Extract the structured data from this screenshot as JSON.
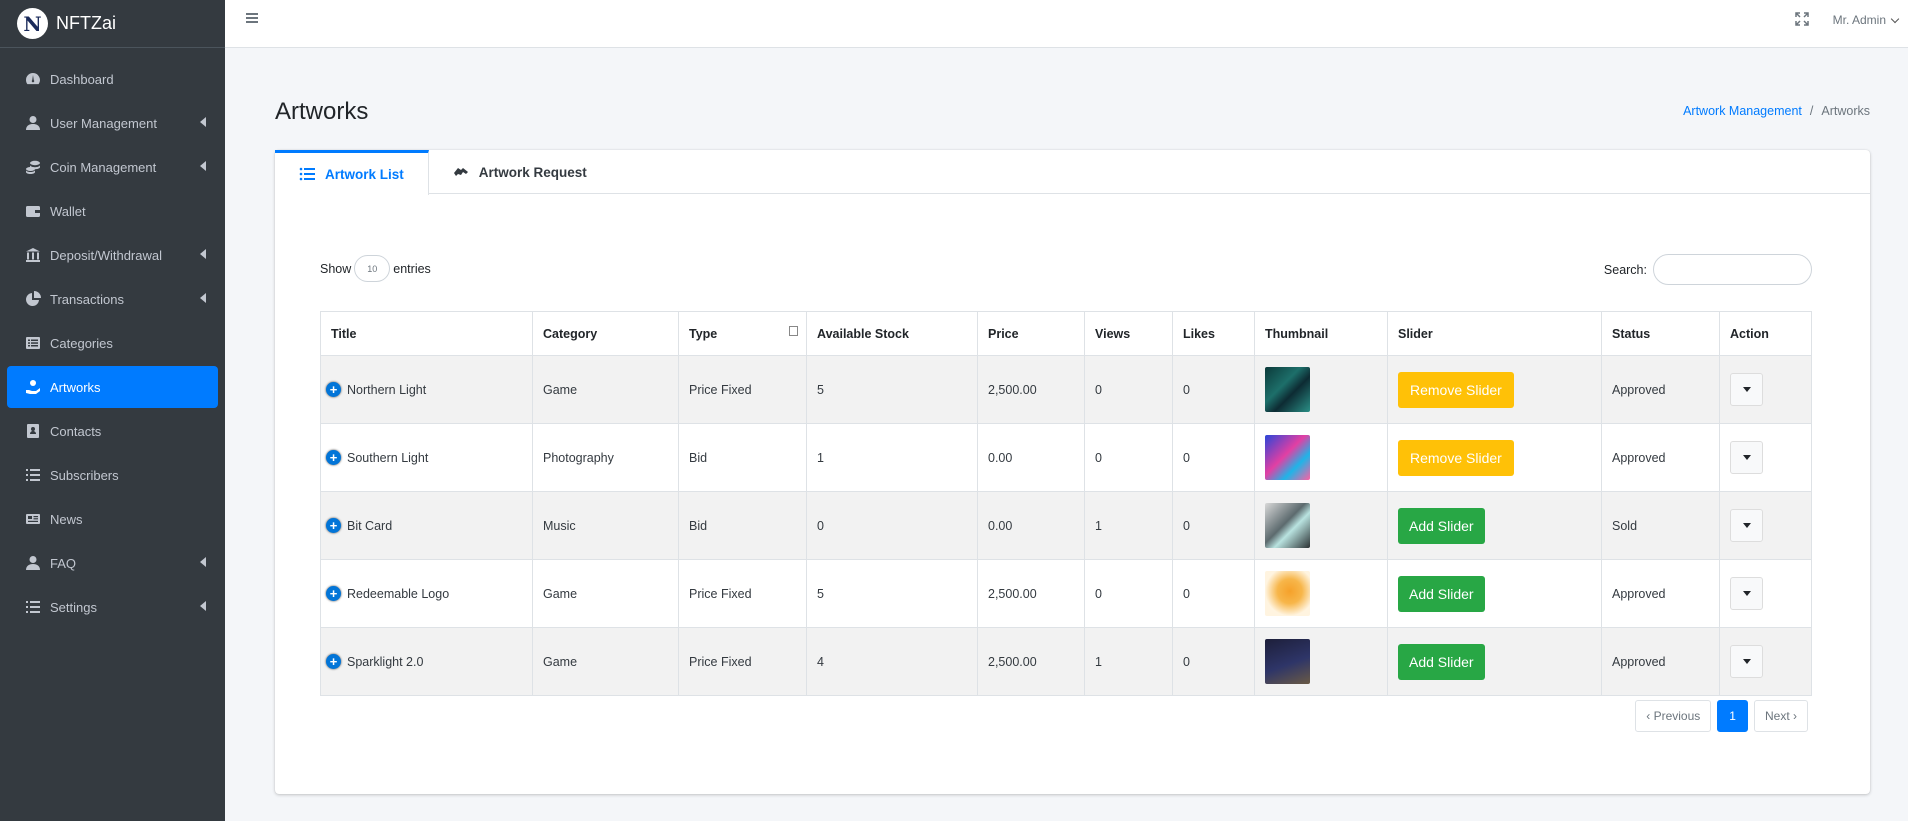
{
  "brand": {
    "logo_letter": "N",
    "name": "NFTZai"
  },
  "sidebar": {
    "items": [
      {
        "label": "Dashboard",
        "icon": "tachometer-icon",
        "chevron": false,
        "active": false
      },
      {
        "label": "User Management",
        "icon": "user-icon",
        "chevron": true,
        "active": false
      },
      {
        "label": "Coin Management",
        "icon": "coins-icon",
        "chevron": true,
        "active": false
      },
      {
        "label": "Wallet",
        "icon": "wallet-icon",
        "chevron": false,
        "active": false
      },
      {
        "label": "Deposit/Withdrawal",
        "icon": "bank-icon",
        "chevron": true,
        "active": false
      },
      {
        "label": "Transactions",
        "icon": "pie-chart-icon",
        "chevron": true,
        "active": false
      },
      {
        "label": "Categories",
        "icon": "list-alt-icon",
        "chevron": false,
        "active": false
      },
      {
        "label": "Artworks",
        "icon": "hand-holding-icon",
        "chevron": false,
        "active": true
      },
      {
        "label": "Contacts",
        "icon": "address-book-icon",
        "chevron": false,
        "active": false
      },
      {
        "label": "Subscribers",
        "icon": "list-icon",
        "chevron": false,
        "active": false
      },
      {
        "label": "News",
        "icon": "newspaper-icon",
        "chevron": false,
        "active": false
      },
      {
        "label": "FAQ",
        "icon": "user-icon",
        "chevron": true,
        "active": false
      },
      {
        "label": "Settings",
        "icon": "list-icon",
        "chevron": true,
        "active": false
      }
    ]
  },
  "topbar": {
    "user": "Mr. Admin"
  },
  "header": {
    "title": "Artworks",
    "breadcrumb_link": "Artwork Management",
    "breadcrumb_sep": "/",
    "breadcrumb_current": "Artworks"
  },
  "tabs": {
    "list": "Artwork List",
    "request": "Artwork Request"
  },
  "controls": {
    "show": "Show",
    "length": "10",
    "entries": "entries",
    "search_label": "Search:"
  },
  "table": {
    "columns": [
      "Title",
      "Category",
      "Type",
      "Available Stock",
      "Price",
      "Views",
      "Likes",
      "Thumbnail",
      "Slider",
      "Status",
      "Action"
    ],
    "rows": [
      {
        "title": "Northern Light",
        "category": "Game",
        "type": "Price Fixed",
        "stock": "5",
        "price": "2,500.00",
        "views": "0",
        "likes": "0",
        "slider": "Remove Slider",
        "slider_kind": "warning",
        "status": "Approved"
      },
      {
        "title": "Southern Light",
        "category": "Photography",
        "type": "Bid",
        "stock": "1",
        "price": "0.00",
        "views": "0",
        "likes": "0",
        "slider": "Remove Slider",
        "slider_kind": "warning",
        "status": "Approved"
      },
      {
        "title": "Bit Card",
        "category": "Music",
        "type": "Bid",
        "stock": "0",
        "price": "0.00",
        "views": "1",
        "likes": "0",
        "slider": "Add Slider",
        "slider_kind": "success",
        "status": "Sold"
      },
      {
        "title": "Redeemable Logo",
        "category": "Game",
        "type": "Price Fixed",
        "stock": "5",
        "price": "2,500.00",
        "views": "0",
        "likes": "0",
        "slider": "Add Slider",
        "slider_kind": "success",
        "status": "Approved"
      },
      {
        "title": "Sparklight 2.0",
        "category": "Game",
        "type": "Price Fixed",
        "stock": "4",
        "price": "2,500.00",
        "views": "1",
        "likes": "0",
        "slider": "Add Slider",
        "slider_kind": "success",
        "status": "Approved"
      }
    ]
  },
  "pagination": {
    "prev": "‹ Previous",
    "page": "1",
    "next": "Next ›"
  },
  "colors": {
    "primary": "#007bff",
    "warning": "#ffc107",
    "success": "#28a745",
    "sidebar": "#343a40"
  }
}
